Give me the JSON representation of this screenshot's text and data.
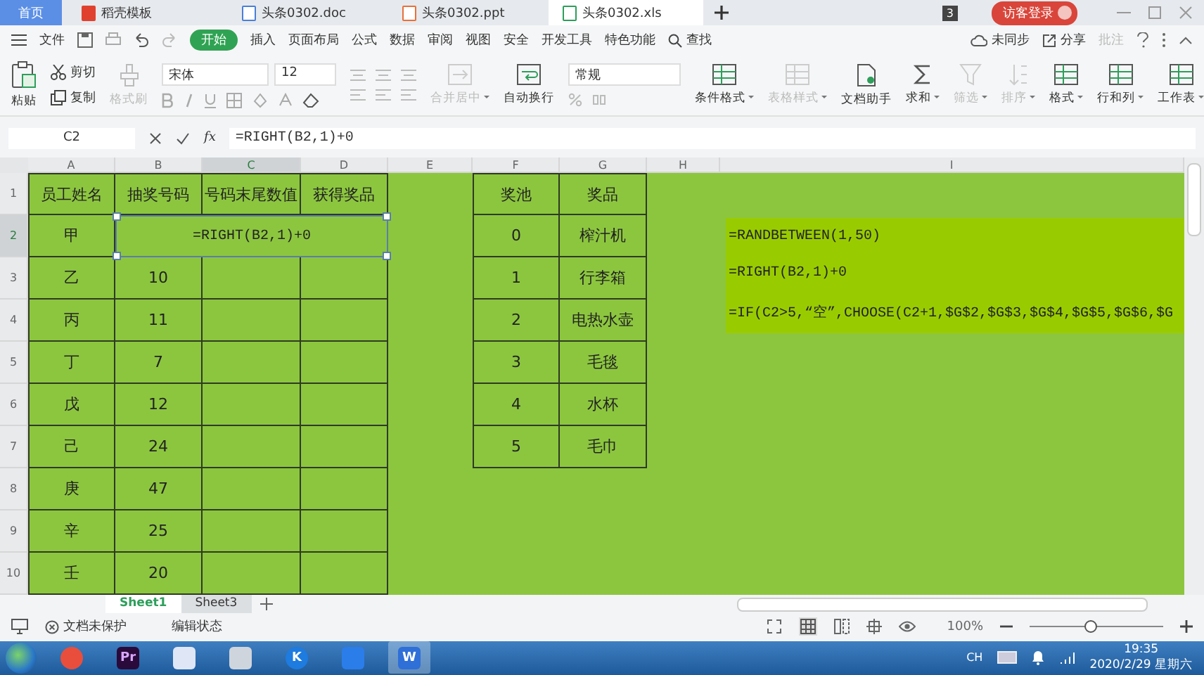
{
  "browser_tabs": [
    {
      "label": "首页",
      "kind": "home",
      "selected": false
    },
    {
      "label": "稻壳模板",
      "kind": "template",
      "selected": false
    },
    {
      "label": "头条0302.doc",
      "kind": "doc",
      "selected": false
    },
    {
      "label": "头条0302.ppt",
      "kind": "ppt",
      "selected": false
    },
    {
      "label": "头条0302.xls",
      "kind": "xls",
      "selected": true
    }
  ],
  "title_bar": {
    "badge": "3",
    "login": "访客登录"
  },
  "menu": {
    "file": "文件",
    "tabs": [
      {
        "label": "开始",
        "selected": true
      },
      {
        "label": "插入",
        "selected": false
      },
      {
        "label": "页面布局",
        "selected": false
      },
      {
        "label": "公式",
        "selected": false
      },
      {
        "label": "数据",
        "selected": false
      },
      {
        "label": "审阅",
        "selected": false
      },
      {
        "label": "视图",
        "selected": false
      },
      {
        "label": "安全",
        "selected": false
      },
      {
        "label": "开发工具",
        "selected": false
      },
      {
        "label": "特色功能",
        "selected": false
      }
    ],
    "search": "查找",
    "sync": "未同步",
    "share": "分享",
    "comment": "批注"
  },
  "ribbon": {
    "paste": "粘贴",
    "cut": "剪切",
    "copy": "复制",
    "format_painter": "格式刷",
    "font": "宋体",
    "font_size": "12",
    "number_format": "常规",
    "buttons": [
      {
        "label": "合并居中",
        "kind": "merge",
        "disabled": true,
        "dropdown": true
      },
      {
        "label": "自动换行",
        "kind": "wrap",
        "disabled": false,
        "dropdown": false
      },
      {
        "label": "条件格式",
        "kind": "grid",
        "disabled": false,
        "dropdown": true
      },
      {
        "label": "表格样式",
        "kind": "grid",
        "disabled": true,
        "dropdown": true
      },
      {
        "label": "文档助手",
        "kind": "doc",
        "disabled": false,
        "dropdown": false
      },
      {
        "label": "求和",
        "kind": "sigma",
        "disabled": false,
        "dropdown": true
      },
      {
        "label": "筛选",
        "kind": "funnel",
        "disabled": true,
        "dropdown": true
      },
      {
        "label": "排序",
        "kind": "sort",
        "disabled": true,
        "dropdown": true
      },
      {
        "label": "格式",
        "kind": "grid",
        "disabled": false,
        "dropdown": true
      },
      {
        "label": "行和列",
        "kind": "grid",
        "disabled": false,
        "dropdown": true
      },
      {
        "label": "工作表",
        "kind": "grid",
        "disabled": false,
        "dropdown": true
      }
    ]
  },
  "formula_bar": {
    "cell": "C2",
    "fx": "fx",
    "formula": "=RIGHT(B2,1)+0"
  },
  "sheet": {
    "columns": [
      {
        "label": "A",
        "selected": false
      },
      {
        "label": "B",
        "selected": false
      },
      {
        "label": "C",
        "selected": true
      },
      {
        "label": "D",
        "selected": false
      },
      {
        "label": "E",
        "selected": false
      },
      {
        "label": "F",
        "selected": false
      },
      {
        "label": "G",
        "selected": false
      },
      {
        "label": "H",
        "selected": false
      },
      {
        "label": "I",
        "selected": false
      }
    ],
    "rows": [
      {
        "label": "1",
        "selected": false
      },
      {
        "label": "2",
        "selected": true
      },
      {
        "label": "3",
        "selected": false
      },
      {
        "label": "4",
        "selected": false
      },
      {
        "label": "5",
        "selected": false
      },
      {
        "label": "6",
        "selected": false
      },
      {
        "label": "7",
        "selected": false
      },
      {
        "label": "8",
        "selected": false
      },
      {
        "label": "9",
        "selected": false
      },
      {
        "label": "10",
        "selected": false
      }
    ],
    "staff_table": {
      "columns": [
        "员工姓名",
        "抽奖号码",
        "号码末尾数值",
        "获得奖品"
      ],
      "rows": [
        {
          "name": "甲",
          "editing": "=RIGHT(B2,1)+0"
        },
        {
          "name": "乙",
          "number": "10"
        },
        {
          "name": "丙",
          "number": "11"
        },
        {
          "name": "丁",
          "number": "7"
        },
        {
          "name": "戊",
          "number": "12"
        },
        {
          "name": "己",
          "number": "24"
        },
        {
          "name": "庚",
          "number": "47"
        },
        {
          "name": "辛",
          "number": "25"
        },
        {
          "name": "壬",
          "number": "20"
        }
      ]
    },
    "prize_table": {
      "columns": [
        "奖池",
        "奖品"
      ],
      "rows": [
        {
          "pool": "0",
          "prize": "榨汁机"
        },
        {
          "pool": "1",
          "prize": "行李箱"
        },
        {
          "pool": "2",
          "prize": "电热水壶"
        },
        {
          "pool": "3",
          "prize": "毛毯"
        },
        {
          "pool": "4",
          "prize": "水杯"
        },
        {
          "pool": "5",
          "prize": "毛巾"
        }
      ]
    },
    "note": [
      "=RANDBETWEEN(1,50)",
      "=RIGHT(B2,1)+0",
      "=IF(C2>5,“空”,CHOOSE(C2+1,$G$2,$G$3,$G$4,$G$5,$G$6,$G"
    ]
  },
  "sheet_tabs": [
    {
      "label": "Sheet1",
      "selected": true
    },
    {
      "label": "Sheet3",
      "selected": false
    }
  ],
  "status_bar": {
    "protection": "文档未保护",
    "mode": "编辑状态",
    "zoom": "100%",
    "zoom_slider": {
      "level": 0.45
    }
  },
  "taskbar": {
    "apps": [
      {
        "kind": "ring",
        "selected": false
      },
      {
        "kind": "pr",
        "label": "Pr",
        "selected": false
      },
      {
        "kind": "bird",
        "selected": false
      },
      {
        "kind": "blob",
        "selected": false
      },
      {
        "kind": "k",
        "label": "K",
        "selected": false
      },
      {
        "kind": "panels",
        "selected": false
      },
      {
        "kind": "w",
        "label": "W",
        "selected": true
      }
    ],
    "input_language": "CH",
    "time": "19:35",
    "date": "2020/2/29 星期六"
  }
}
